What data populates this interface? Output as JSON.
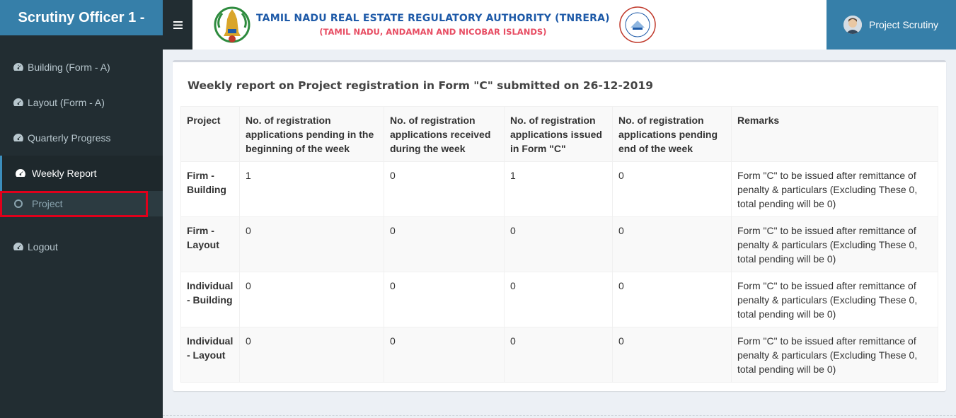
{
  "sidebar": {
    "brand": "Scrutiny Officer 1 -",
    "items": [
      {
        "label": "Building (Form - A)",
        "icon": "dashboard-icon"
      },
      {
        "label": "Layout (Form - A)",
        "icon": "dashboard-icon"
      },
      {
        "label": "Quarterly Progress",
        "icon": "dashboard-icon"
      },
      {
        "label": "Weekly Report",
        "icon": "dashboard-icon",
        "active": true
      }
    ],
    "submenu": {
      "label": "Project",
      "icon": "circle-icon"
    },
    "logout": {
      "label": "Logout",
      "icon": "dashboard-icon"
    }
  },
  "header": {
    "toggle_icon": "hamburger-icon",
    "title": "TAMIL NADU REAL ESTATE REGULATORY AUTHORITY (TNRERA)",
    "subtitle": "(TAMIL NADU, ANDAMAN AND NICOBAR ISLANDS)",
    "user": "Project Scrutiny",
    "colors": {
      "brand": "#367fa9",
      "sidebar": "#222d32",
      "title": "#1e5aa8",
      "subtitle": "#e74c62",
      "highlight": "#e0001b"
    }
  },
  "report": {
    "title": "Weekly report on Project registration in Form \"C\" submitted on 26-12-2019",
    "columns": [
      "Project",
      "No. of registration applications pending in the beginning of the week",
      "No. of registration applications received during the week",
      "No. of registration applications issued in Form \"C\"",
      "No. of registration applications pending end of the week",
      "Remarks"
    ],
    "rows": [
      [
        "Firm - Building",
        "1",
        "0",
        "1",
        "0",
        "Form \"C\" to be issued after remittance of penalty & particulars (Excluding These 0, total pending will be 0)"
      ],
      [
        "Firm - Layout",
        "0",
        "0",
        "0",
        "0",
        "Form \"C\" to be issued after remittance of penalty & particulars (Excluding These 0, total pending will be 0)"
      ],
      [
        "Individual - Building",
        "0",
        "0",
        "0",
        "0",
        "Form \"C\" to be issued after remittance of penalty & particulars (Excluding These 0, total pending will be 0)"
      ],
      [
        "Individual - Layout",
        "0",
        "0",
        "0",
        "0",
        "Form \"C\" to be issued after remittance of penalty & particulars (Excluding These 0, total pending will be 0)"
      ]
    ]
  }
}
